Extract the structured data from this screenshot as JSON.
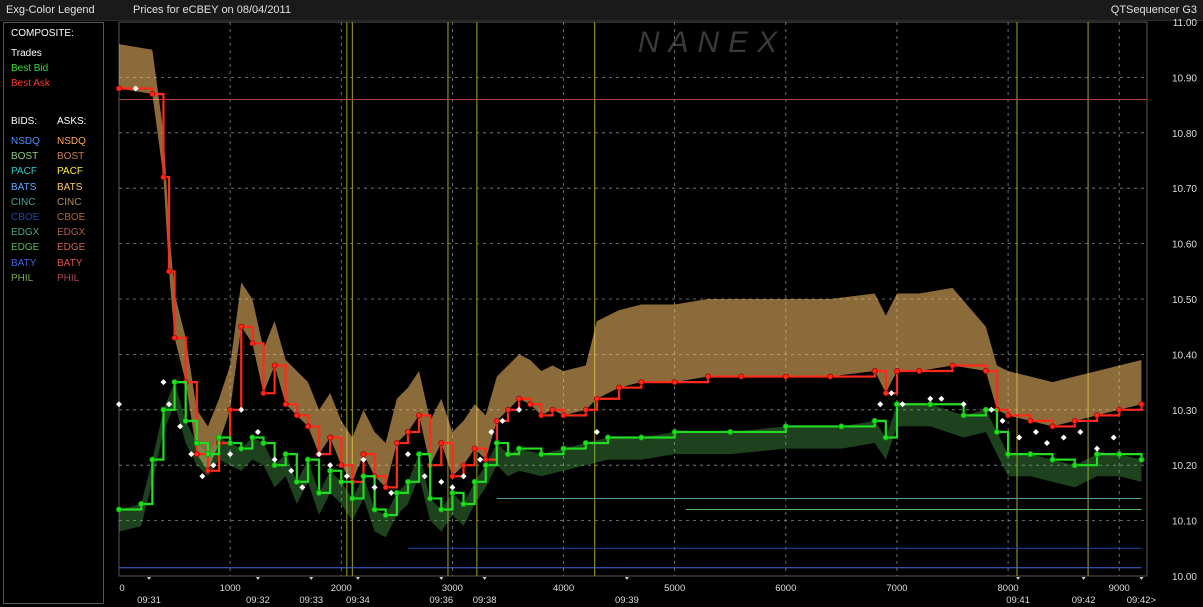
{
  "header": {
    "legend_title": "Exg-Color Legend",
    "prices_for": "Prices for  eCBEY  on  08/04/2011",
    "product": "QTSequencer G3",
    "watermark": "NANEX"
  },
  "legend": {
    "composite_title": "COMPOSITE:",
    "composite": [
      {
        "label": "Trades",
        "color": "#ffffff"
      },
      {
        "label": "Best Bid",
        "color": "#33dd33"
      },
      {
        "label": "Best Ask",
        "color": "#ff3333"
      }
    ],
    "bids_title": "BIDS:",
    "asks_title": "ASKS:",
    "exchanges": [
      {
        "bid": "NSDQ",
        "ask": "NSDQ",
        "bid_color": "#4f8cff",
        "ask_color": "#ffa64d"
      },
      {
        "bid": "BOST",
        "ask": "BOST",
        "bid_color": "#8fc87a",
        "ask_color": "#c87a5a"
      },
      {
        "bid": "PACF",
        "ask": "PACF",
        "bid_color": "#33cccc",
        "ask_color": "#ffee33"
      },
      {
        "bid": "BATS",
        "ask": "BATS",
        "bid_color": "#66aaff",
        "ask_color": "#ffcc66"
      },
      {
        "bid": "CINC",
        "ask": "CINC",
        "bid_color": "#4fa0a0",
        "ask_color": "#b09060"
      },
      {
        "bid": "CBOE",
        "ask": "CBOE",
        "bid_color": "#2244aa",
        "ask_color": "#b06a2a"
      },
      {
        "bid": "EDGX",
        "ask": "EDGX",
        "bid_color": "#44aa88",
        "ask_color": "#b05a50"
      },
      {
        "bid": "EDGE",
        "ask": "EDGE",
        "bid_color": "#55bb55",
        "ask_color": "#cc6050"
      },
      {
        "bid": "BATY",
        "ask": "BATY",
        "bid_color": "#4466dd",
        "ask_color": "#dd5555"
      },
      {
        "bid": "PHIL",
        "ask": "PHIL",
        "bid_color": "#77aa44",
        "ask_color": "#aa4455"
      }
    ]
  },
  "chart_data": {
    "type": "line",
    "title": "Prices for  eCBEY  on  08/04/2011",
    "ylim": [
      10.0,
      11.0
    ],
    "y_ticks": [
      "11.00",
      "10.90",
      "10.80",
      "10.70",
      "10.60",
      "10.50",
      "10.40",
      "10.30",
      "10.20",
      "10.10",
      "10.00"
    ],
    "xlim": [
      0,
      9250
    ],
    "x_ticks": [
      "0",
      "1000",
      "2000",
      "3000",
      "4000",
      "5000",
      "6000",
      "7000",
      "8000",
      "9000"
    ],
    "time_labels": [
      {
        "x": 270,
        "label": "09:31"
      },
      {
        "x": 1250,
        "label": "09:32"
      },
      {
        "x": 1730,
        "label": "09:33"
      },
      {
        "x": 2150,
        "label": "09:34"
      },
      {
        "x": 2900,
        "label": "09:36"
      },
      {
        "x": 3290,
        "label": "09:38"
      },
      {
        "x": 4570,
        "label": "09:39"
      },
      {
        "x": 8090,
        "label": "09:41"
      },
      {
        "x": 8680,
        "label": "09:42"
      },
      {
        "x": 9200,
        "label": "09:42>"
      }
    ],
    "grid": true,
    "series": [
      {
        "name": "Best Ask",
        "color": "#ff2a1a",
        "x": [
          0,
          300,
          400,
          450,
          500,
          600,
          700,
          800,
          900,
          1000,
          1100,
          1200,
          1300,
          1400,
          1500,
          1600,
          1700,
          1800,
          1900,
          2000,
          2100,
          2200,
          2300,
          2400,
          2500,
          2600,
          2700,
          2800,
          2900,
          3000,
          3100,
          3200,
          3300,
          3400,
          3500,
          3600,
          3700,
          3800,
          3900,
          4000,
          4200,
          4300,
          4500,
          4700,
          5000,
          5300,
          5600,
          6000,
          6400,
          6800,
          6900,
          7000,
          7200,
          7500,
          7800,
          7900,
          8000,
          8200,
          8400,
          8600,
          8800,
          9000,
          9200
        ],
        "y": [
          10.88,
          10.87,
          10.72,
          10.55,
          10.43,
          10.35,
          10.22,
          10.19,
          10.24,
          10.3,
          10.45,
          10.42,
          10.33,
          10.38,
          10.31,
          10.29,
          10.27,
          10.22,
          10.25,
          10.2,
          10.17,
          10.22,
          10.18,
          10.16,
          10.24,
          10.26,
          10.29,
          10.2,
          10.24,
          10.18,
          10.2,
          10.23,
          10.21,
          10.28,
          10.3,
          10.32,
          10.31,
          10.29,
          10.3,
          10.29,
          10.3,
          10.32,
          10.34,
          10.35,
          10.35,
          10.36,
          10.36,
          10.36,
          10.36,
          10.37,
          10.33,
          10.37,
          10.37,
          10.38,
          10.37,
          10.3,
          10.29,
          10.28,
          10.27,
          10.28,
          10.29,
          10.3,
          10.31
        ]
      },
      {
        "name": "Best Bid",
        "color": "#22dd22",
        "x": [
          0,
          200,
          300,
          400,
          500,
          600,
          700,
          800,
          900,
          1000,
          1100,
          1200,
          1300,
          1400,
          1500,
          1600,
          1700,
          1800,
          1900,
          2000,
          2100,
          2200,
          2300,
          2400,
          2500,
          2600,
          2700,
          2800,
          2900,
          3000,
          3100,
          3200,
          3300,
          3400,
          3500,
          3600,
          3800,
          4000,
          4200,
          4400,
          4700,
          5000,
          5500,
          6000,
          6500,
          6800,
          6900,
          7000,
          7300,
          7600,
          7800,
          7900,
          8000,
          8200,
          8400,
          8600,
          8800,
          9000,
          9200
        ],
        "y": [
          10.12,
          10.13,
          10.21,
          10.3,
          10.35,
          10.28,
          10.24,
          10.22,
          10.25,
          10.24,
          10.23,
          10.25,
          10.24,
          10.2,
          10.22,
          10.17,
          10.21,
          10.15,
          10.19,
          10.17,
          10.14,
          10.18,
          10.12,
          10.11,
          10.15,
          10.17,
          10.22,
          10.14,
          10.12,
          10.15,
          10.13,
          10.17,
          10.2,
          10.24,
          10.22,
          10.23,
          10.22,
          10.23,
          10.24,
          10.25,
          10.25,
          10.26,
          10.26,
          10.27,
          10.27,
          10.28,
          10.25,
          10.31,
          10.31,
          10.29,
          10.3,
          10.26,
          10.22,
          10.22,
          10.21,
          10.2,
          10.22,
          10.22,
          10.21
        ]
      },
      {
        "name": "Trades",
        "color": "#ffffff",
        "x": [
          0,
          150,
          400,
          450,
          550,
          650,
          750,
          850,
          1000,
          1100,
          1250,
          1400,
          1550,
          1650,
          1800,
          1900,
          2050,
          2200,
          2300,
          2450,
          2600,
          2750,
          2900,
          3000,
          3100,
          3250,
          3350,
          3450,
          3600,
          4300,
          6850,
          6950,
          7050,
          7300,
          7400,
          7600,
          7850,
          7950,
          8100,
          8250,
          8350,
          8500,
          8650,
          8800,
          8950
        ],
        "y": [
          10.31,
          10.88,
          10.35,
          10.31,
          10.27,
          10.22,
          10.18,
          10.2,
          10.22,
          10.3,
          10.26,
          10.21,
          10.19,
          10.16,
          10.22,
          10.2,
          10.18,
          10.21,
          10.16,
          10.15,
          10.22,
          10.18,
          10.17,
          10.16,
          10.18,
          10.21,
          10.26,
          10.28,
          10.3,
          10.26,
          10.31,
          10.33,
          10.31,
          10.32,
          10.32,
          10.31,
          10.3,
          10.28,
          10.25,
          10.26,
          10.24,
          10.25,
          10.26,
          10.23,
          10.25
        ]
      }
    ]
  }
}
